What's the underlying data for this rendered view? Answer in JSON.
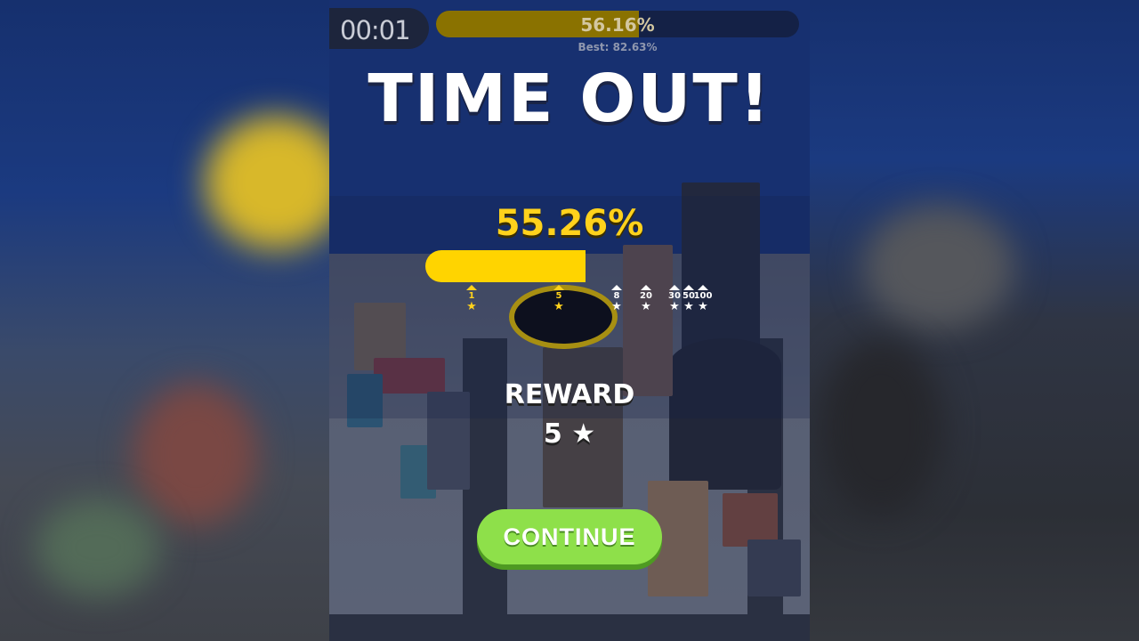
{
  "hud": {
    "timer": "00:01",
    "top_progress_text": "56.16%",
    "top_progress_value": 0.5616,
    "best_text": "Best: 82.63%"
  },
  "result": {
    "title": "TIME OUT!",
    "percent_text": "55.26%",
    "percent_value": 0.5526,
    "milestones": [
      {
        "label": "1",
        "reached": true
      },
      {
        "label": "5",
        "reached": true
      },
      {
        "label": "8",
        "reached": false
      },
      {
        "label": "20",
        "reached": false
      },
      {
        "label": "30",
        "reached": false
      },
      {
        "label": "50",
        "reached": false
      },
      {
        "label": "100",
        "reached": false
      }
    ],
    "reward_label": "REWARD",
    "reward_amount": "5",
    "reward_icon": "star-icon",
    "continue_label": "CONTINUE"
  },
  "colors": {
    "accent_yellow": "#ffd400",
    "continue_green": "#8ee04a",
    "sky_blue": "#1b3f96"
  }
}
